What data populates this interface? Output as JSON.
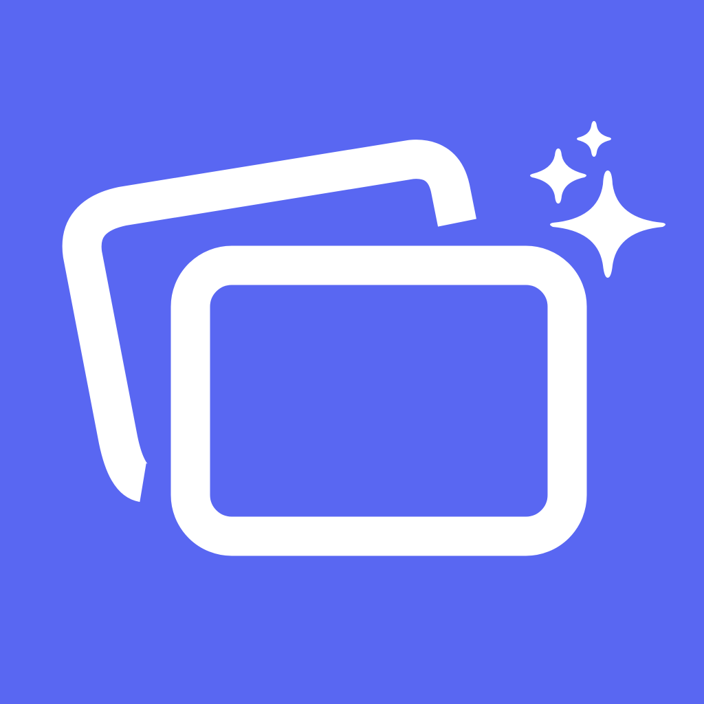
{
  "icon": {
    "name": "photo-cards-sparkle-icon",
    "colors": {
      "background": "#5967F2",
      "foreground": "#FFFFFF"
    }
  }
}
